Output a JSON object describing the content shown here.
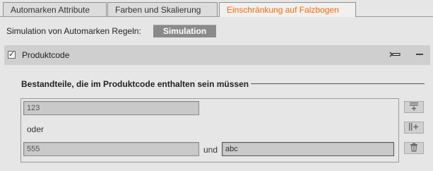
{
  "tabs": [
    {
      "label": "Automarken Attribute"
    },
    {
      "label": "Farben und Skalierung"
    },
    {
      "label": "Einschränkung auf Falzbogen"
    }
  ],
  "simulation": {
    "label": "Simulation von Automarken Regeln:",
    "button_label": "Simulation"
  },
  "section": {
    "title": "Produktcode",
    "checked": true
  },
  "group": {
    "title": "Bestandteile, die im Produktcode enthalten sein müssen",
    "rows": [
      {
        "value": "123"
      },
      {
        "separator": "oder"
      },
      {
        "value": "555",
        "joiner": "und",
        "value2": "abc"
      }
    ]
  },
  "icons": {
    "checkbox": "checkmark-icon",
    "collapse": "collapse-icon",
    "minimize": "minus-icon",
    "add_or": "add-or-row-icon",
    "add_and": "add-and-column-icon",
    "delete": "trash-icon"
  },
  "colors": {
    "active_tab_text": "#ff6a00",
    "button_bg": "#8a8a8a",
    "header_bg": "#cfcfcf"
  }
}
